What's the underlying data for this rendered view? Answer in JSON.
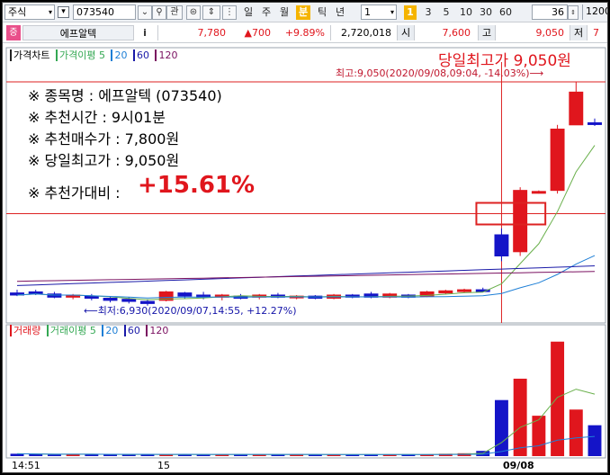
{
  "toolbar": {
    "market": "주식",
    "code": "073540",
    "btn_gwan": "관",
    "periods": [
      "일",
      "주",
      "월",
      "분",
      "틱",
      "년"
    ],
    "active_period": "분",
    "interval_select": "1",
    "intervals": [
      "1",
      "3",
      "5",
      "10",
      "30",
      "60"
    ],
    "active_interval": "1",
    "count": "36",
    "total": "1200"
  },
  "quote": {
    "badge": "증",
    "name": "에프알텍",
    "info_btn": "i",
    "price": "7,780",
    "change": "▲700",
    "change_pct": "+9.89%",
    "volume": "2,720,018",
    "open_label": "시",
    "open": "7,600",
    "high_label": "고",
    "high": "9,050",
    "low_label": "저",
    "low_partial": "7"
  },
  "price_pane": {
    "legend": [
      "가격차트",
      "가격이평 5",
      "20",
      "60",
      "120"
    ],
    "legend_colors": [
      "#222222",
      "#34a853",
      "#1e7fd6",
      "#1a1aa8",
      "#7a1060"
    ],
    "headline": "당일최고가 9,050원",
    "max_annotation": "최고:9,050(2020/09/08,09:04, -14.03%)⟶",
    "min_annotation": "⟵최저:6,930(2020/09/07,14:55, +12.27%)",
    "info_lines": [
      "※ 종목명 : 에프알텍 (073540)",
      "※ 추천시간 : 9시01분",
      "※ 추천매수가 : 7,800원",
      "※ 당일최고가 : 9,050원"
    ],
    "ratio_label": "※ 추천가대비 :",
    "ratio_value": "+15.61%"
  },
  "volume_pane": {
    "legend": [
      "거래량",
      "거래이평 5",
      "20",
      "60",
      "120"
    ],
    "legend_colors": [
      "#e0161d",
      "#34a853",
      "#1e7fd6",
      "#1a1aa8",
      "#7a1060"
    ]
  },
  "x_axis": {
    "labels": [
      "14:51",
      "15",
      "09/08"
    ]
  },
  "colors": {
    "up": "#e0161d",
    "down": "#1414c8",
    "ma5": "#6ab04c",
    "ma20": "#1e7fd6",
    "ma60": "#1a1aa8",
    "ma120": "#7a1060",
    "ref_line": "#d22"
  },
  "chart_data": {
    "type": "candlestick",
    "candles": [
      {
        "o": 7050,
        "h": 7080,
        "l": 7020,
        "c": 7030
      },
      {
        "o": 7060,
        "h": 7080,
        "l": 7030,
        "c": 7050
      },
      {
        "o": 7040,
        "h": 7060,
        "l": 7000,
        "c": 7010
      },
      {
        "o": 7010,
        "h": 7040,
        "l": 6990,
        "c": 7030
      },
      {
        "o": 7020,
        "h": 7040,
        "l": 6980,
        "c": 7000
      },
      {
        "o": 7000,
        "h": 7020,
        "l": 6960,
        "c": 6980
      },
      {
        "o": 6990,
        "h": 7010,
        "l": 6950,
        "c": 6970
      },
      {
        "o": 6970,
        "h": 6990,
        "l": 6930,
        "c": 6950
      },
      {
        "o": 6980,
        "h": 7070,
        "l": 6970,
        "c": 7060
      },
      {
        "o": 7050,
        "h": 7060,
        "l": 7000,
        "c": 7020
      },
      {
        "o": 7030,
        "h": 7060,
        "l": 6990,
        "c": 7010
      },
      {
        "o": 7010,
        "h": 7040,
        "l": 6980,
        "c": 7030
      },
      {
        "o": 7020,
        "h": 7040,
        "l": 6990,
        "c": 7000
      },
      {
        "o": 7010,
        "h": 7040,
        "l": 6990,
        "c": 7030
      },
      {
        "o": 7030,
        "h": 7050,
        "l": 7000,
        "c": 7010
      },
      {
        "o": 7010,
        "h": 7030,
        "l": 6990,
        "c": 7020
      },
      {
        "o": 7020,
        "h": 7030,
        "l": 6990,
        "c": 7000
      },
      {
        "o": 7000,
        "h": 7040,
        "l": 6990,
        "c": 7030
      },
      {
        "o": 7030,
        "h": 7040,
        "l": 7000,
        "c": 7010
      },
      {
        "o": 7040,
        "h": 7060,
        "l": 7000,
        "c": 7010
      },
      {
        "o": 7010,
        "h": 7050,
        "l": 7000,
        "c": 7040
      },
      {
        "o": 7030,
        "h": 7040,
        "l": 7000,
        "c": 7010
      },
      {
        "o": 7020,
        "h": 7070,
        "l": 7010,
        "c": 7060
      },
      {
        "o": 7050,
        "h": 7080,
        "l": 7040,
        "c": 7070
      },
      {
        "o": 7070,
        "h": 7090,
        "l": 7050,
        "c": 7080
      },
      {
        "o": 7080,
        "h": 7100,
        "l": 7060,
        "c": 7070
      },
      {
        "o": 7600,
        "h": 7660,
        "l": 7350,
        "c": 7400
      },
      {
        "o": 7440,
        "h": 8050,
        "l": 7400,
        "c": 8020
      },
      {
        "o": 8000,
        "h": 8020,
        "l": 7990,
        "c": 8010
      },
      {
        "o": 8020,
        "h": 8640,
        "l": 7990,
        "c": 8600
      },
      {
        "o": 8640,
        "h": 9050,
        "l": 8640,
        "c": 8950
      },
      {
        "o": 8660,
        "h": 8700,
        "l": 8630,
        "c": 8650
      }
    ],
    "volumes": [
      5,
      4,
      3,
      4,
      4,
      3,
      3,
      4,
      3,
      4,
      3,
      3,
      4,
      3,
      3,
      4,
      3,
      3,
      3,
      4,
      3,
      4,
      3,
      5,
      6,
      11,
      118,
      163,
      85,
      241,
      98,
      65
    ],
    "price_range": [
      6800,
      9200
    ],
    "reference_price": 7800
  }
}
